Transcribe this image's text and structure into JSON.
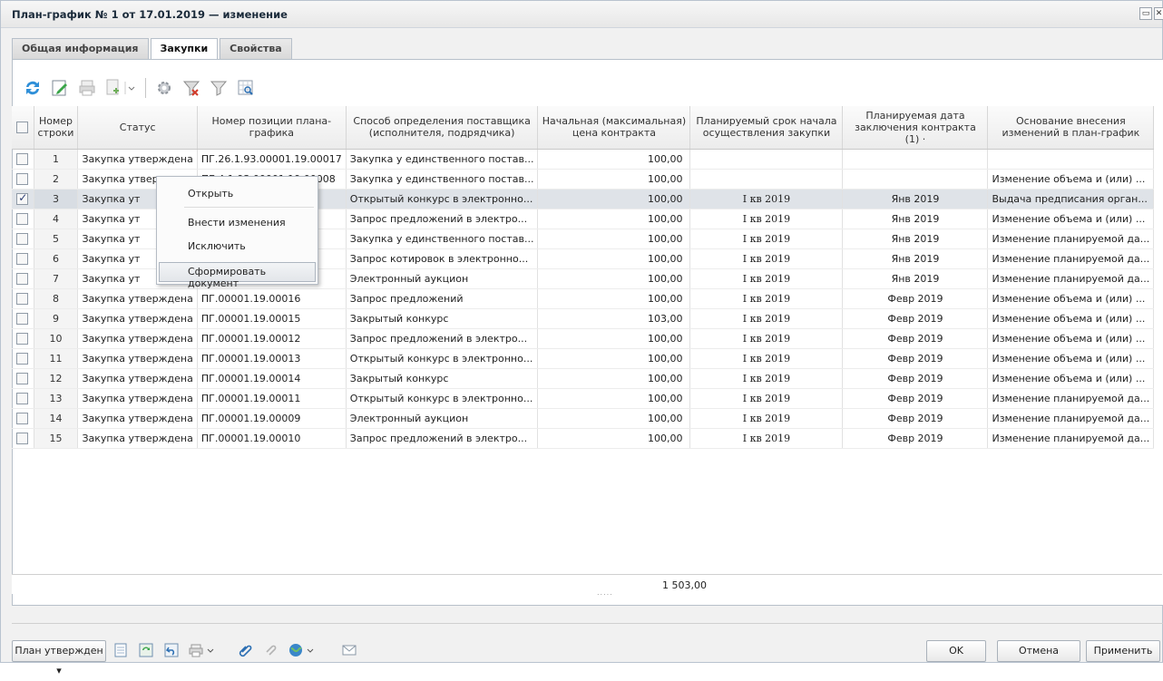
{
  "window": {
    "title": "План-график № 1 от 17.01.2019 — изменение",
    "close_glyph": "✕"
  },
  "tabs": [
    {
      "label": "Общая информация"
    },
    {
      "label": "Закупки"
    },
    {
      "label": "Свойства"
    }
  ],
  "toolbar": {
    "icons": [
      "refresh-icon",
      "edit-icon",
      "print-icon",
      "add-document-icon",
      "settings-icon",
      "filter-clear-icon",
      "filter-icon",
      "find-icon"
    ]
  },
  "table": {
    "headers": [
      "",
      "Номер строки",
      "Статус",
      "Номер позиции плана-графика",
      "Способ определения поставщика (исполнителя, подрядчика)",
      "Начальная (максимальная) цена контракта",
      "Планируемый срок начала осуществления закупки",
      "Планируемая дата заключения контракта (1) ·",
      "Основание внесения изменений в план-график"
    ],
    "rows": [
      {
        "n": "1",
        "status": "Закупка утверждена",
        "pos": "ПГ.26.1.93.00001.19.00017",
        "method": "Закупка у единственного постав...",
        "price": "100,00",
        "start": "",
        "date": "",
        "reason": "",
        "checked": false
      },
      {
        "n": "2",
        "status": "Закупка утверждена",
        "pos": "ПГ.4.1.93.00001.19.00008",
        "method": "Закупка у единственного постав...",
        "price": "100,00",
        "start": "",
        "date": "",
        "reason": "Изменение объема и (или) ...",
        "checked": false
      },
      {
        "n": "3",
        "status": "Закупка ут",
        "pos": "",
        "method": "Открытый конкурс в электронно...",
        "price": "100,00",
        "start": "I кв 2019",
        "date": "Янв 2019",
        "reason": "Выдача предписания орган...",
        "checked": true
      },
      {
        "n": "4",
        "status": "Закупка ут",
        "pos": "",
        "method": "Запрос предложений в электро...",
        "price": "100,00",
        "start": "I кв 2019",
        "date": "Янв 2019",
        "reason": "Изменение объема и (или) ...",
        "checked": false
      },
      {
        "n": "5",
        "status": "Закупка ут",
        "pos": "",
        "method": "Закупка у единственного постав...",
        "price": "100,00",
        "start": "I кв 2019",
        "date": "Янв 2019",
        "reason": "Изменение планируемой да...",
        "checked": false
      },
      {
        "n": "6",
        "status": "Закупка ут",
        "pos": "",
        "method": "Запрос котировок в электронно...",
        "price": "100,00",
        "start": "I кв 2019",
        "date": "Янв 2019",
        "reason": "Изменение планируемой да...",
        "checked": false
      },
      {
        "n": "7",
        "status": "Закупка ут",
        "pos": "",
        "method": "Электронный аукцион",
        "price": "100,00",
        "start": "I кв 2019",
        "date": "Янв 2019",
        "reason": "Изменение планируемой да...",
        "checked": false
      },
      {
        "n": "8",
        "status": "Закупка утверждена",
        "pos": "ПГ.00001.19.00016",
        "method": "Запрос предложений",
        "price": "100,00",
        "start": "I кв 2019",
        "date": "Февр 2019",
        "reason": "Изменение объема и (или) ...",
        "checked": false
      },
      {
        "n": "9",
        "status": "Закупка утверждена",
        "pos": "ПГ.00001.19.00015",
        "method": "Закрытый конкурс",
        "price": "103,00",
        "start": "I кв 2019",
        "date": "Февр 2019",
        "reason": "Изменение объема и (или) ...",
        "checked": false
      },
      {
        "n": "10",
        "status": "Закупка утверждена",
        "pos": "ПГ.00001.19.00012",
        "method": "Запрос предложений в электро...",
        "price": "100,00",
        "start": "I кв 2019",
        "date": "Февр 2019",
        "reason": "Изменение объема и (или) ...",
        "checked": false
      },
      {
        "n": "11",
        "status": "Закупка утверждена",
        "pos": "ПГ.00001.19.00013",
        "method": "Открытый конкурс в электронно...",
        "price": "100,00",
        "start": "I кв 2019",
        "date": "Февр 2019",
        "reason": "Изменение объема и (или) ...",
        "checked": false
      },
      {
        "n": "12",
        "status": "Закупка утверждена",
        "pos": "ПГ.00001.19.00014",
        "method": "Закрытый конкурс",
        "price": "100,00",
        "start": "I кв 2019",
        "date": "Февр 2019",
        "reason": "Изменение объема и (или) ...",
        "checked": false
      },
      {
        "n": "13",
        "status": "Закупка утверждена",
        "pos": "ПГ.00001.19.00011",
        "method": "Открытый конкурс в электронно...",
        "price": "100,00",
        "start": "I кв 2019",
        "date": "Февр 2019",
        "reason": "Изменение планируемой да...",
        "checked": false
      },
      {
        "n": "14",
        "status": "Закупка утверждена",
        "pos": "ПГ.00001.19.00009",
        "method": "Электронный аукцион",
        "price": "100,00",
        "start": "I кв 2019",
        "date": "Февр 2019",
        "reason": "Изменение планируемой да...",
        "checked": false
      },
      {
        "n": "15",
        "status": "Закупка утверждена",
        "pos": "ПГ.00001.19.00010",
        "method": "Запрос предложений в электро...",
        "price": "100,00",
        "start": "I кв 2019",
        "date": "Февр 2019",
        "reason": "Изменение планируемой да...",
        "checked": false
      }
    ],
    "total": "1 503,00",
    "resize_dots": "....."
  },
  "context_menu": {
    "open": "Открыть",
    "make_changes": "Внести изменения",
    "exclude": "Исключить",
    "generate_document": "Сформировать документ"
  },
  "bottom": {
    "status_button": "План утвержден",
    "ok": "OK",
    "cancel": "Отмена",
    "apply": "Применить"
  },
  "colors": {
    "selection": "#dfe3e8",
    "accent": "#2c3e74"
  }
}
